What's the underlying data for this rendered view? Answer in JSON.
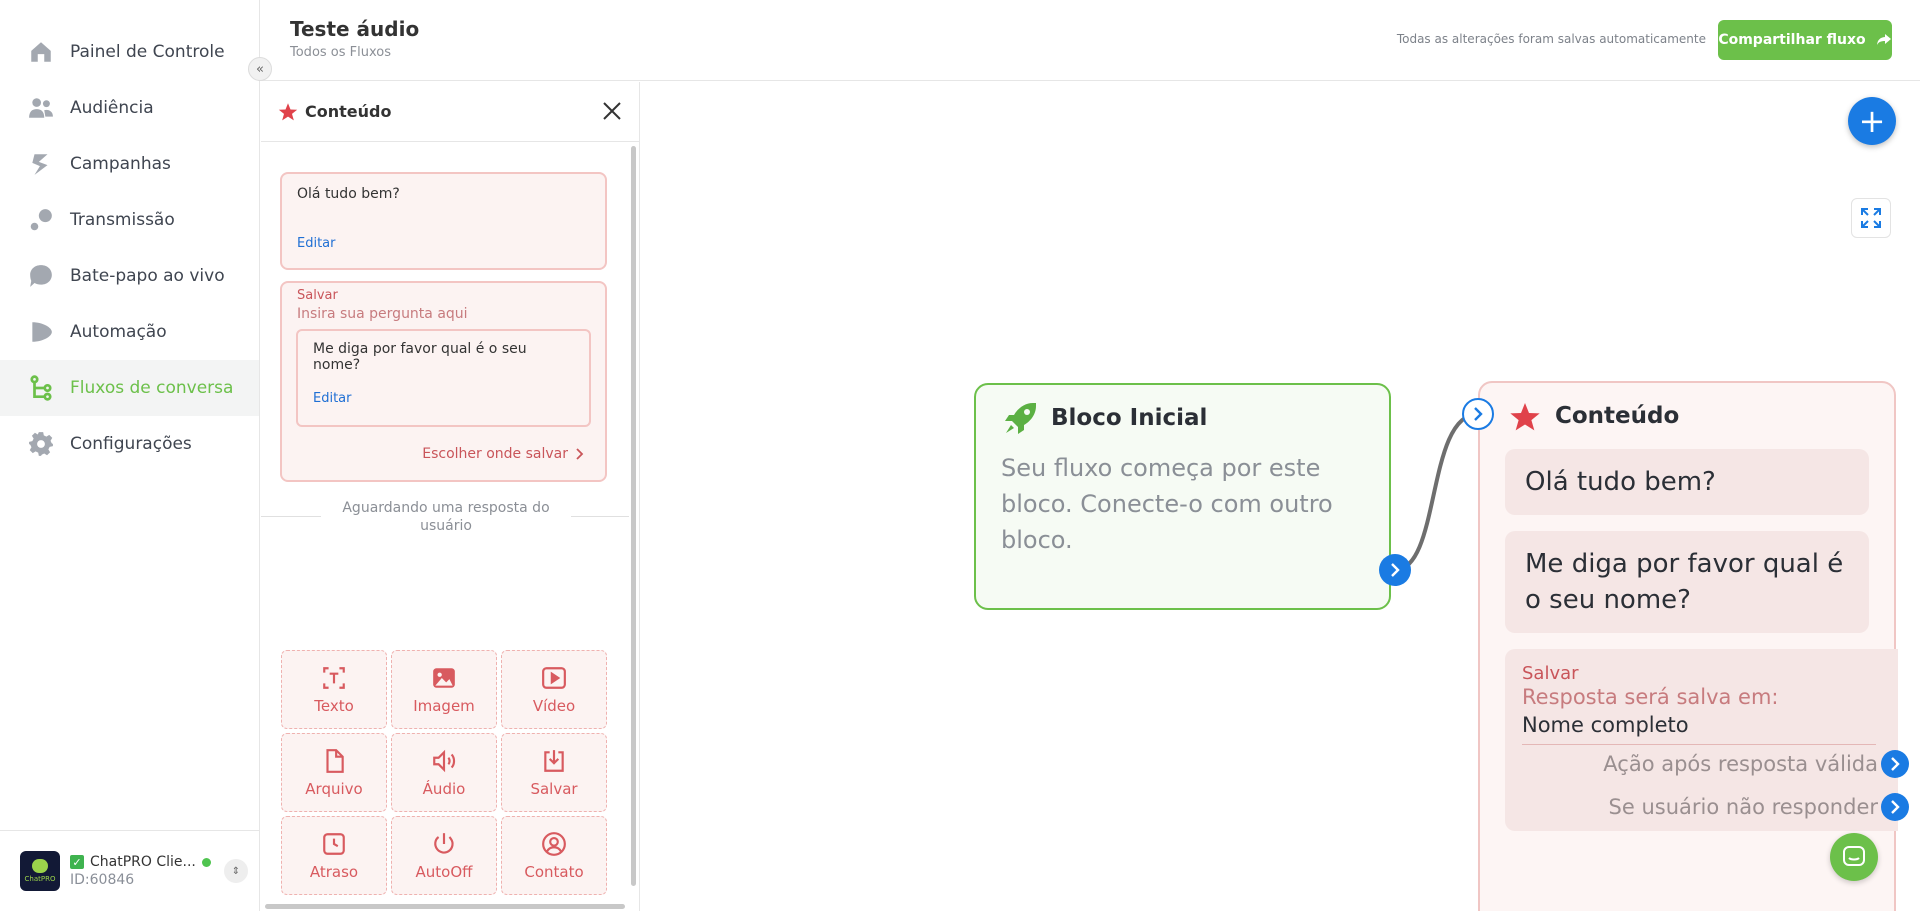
{
  "sidebar": {
    "items": [
      {
        "label": "Painel de Controle",
        "icon": "home-icon",
        "active": false
      },
      {
        "label": "Audiência",
        "icon": "people-icon",
        "active": false
      },
      {
        "label": "Campanhas",
        "icon": "bolt-icon",
        "active": false
      },
      {
        "label": "Transmissão",
        "icon": "broadcast-icon",
        "active": false
      },
      {
        "label": "Bate-papo ao vivo",
        "icon": "chat-bubble-icon",
        "active": false
      },
      {
        "label": "Automação",
        "icon": "play-icon",
        "active": false
      },
      {
        "label": "Fluxos de conversa",
        "icon": "flow-icon",
        "active": true
      },
      {
        "label": "Configurações",
        "icon": "gear-icon",
        "active": false
      }
    ],
    "account": {
      "name": "ChatPRO Clie...",
      "id": "ID:60846",
      "logo_text": "ChatPRO"
    }
  },
  "header": {
    "title": "Teste áudio",
    "breadcrumb": "Todos os Fluxos",
    "saved_status": "Todas as alterações foram salvas automaticamente",
    "share_label": "Compartilhar fluxo"
  },
  "panel": {
    "title": "Conteúdo",
    "message1": {
      "text": "Olá tudo bem?",
      "edit": "Editar"
    },
    "save": {
      "label": "Salvar",
      "hint": "Insira sua pergunta aqui",
      "question": "Me diga por favor qual é o seu nome?",
      "edit": "Editar",
      "choose": "Escolher onde salvar"
    },
    "waiting": "Aguardando uma resposta do usuário",
    "tools": [
      {
        "label": "Texto",
        "icon": "text-icon"
      },
      {
        "label": "Imagem",
        "icon": "image-icon"
      },
      {
        "label": "Vídeo",
        "icon": "video-icon"
      },
      {
        "label": "Arquivo",
        "icon": "file-icon"
      },
      {
        "label": "Áudio",
        "icon": "audio-icon"
      },
      {
        "label": "Salvar",
        "icon": "download-icon"
      },
      {
        "label": "Atraso",
        "icon": "clock-icon"
      },
      {
        "label": "AutoOff",
        "icon": "power-icon"
      },
      {
        "label": "Contato",
        "icon": "contact-icon"
      }
    ]
  },
  "canvas": {
    "start_block": {
      "title": "Bloco Inicial",
      "description": "Seu fluxo começa por este bloco. Conecte-o com outro bloco."
    },
    "content_block": {
      "title": "Conteúdo",
      "message1": "Olá tudo bem?",
      "message2": "Me diga por favor qual é o seu nome?",
      "save_label": "Salvar",
      "save_hint": "Resposta será salva em:",
      "save_field": "Nome completo",
      "valid_action": "Ação após resposta válida",
      "no_reply": "Se usuário não responder"
    }
  },
  "colors": {
    "brand_green": "#6cc04a",
    "primary_blue": "#1a7be3",
    "accent_red": "#d85a5f"
  }
}
